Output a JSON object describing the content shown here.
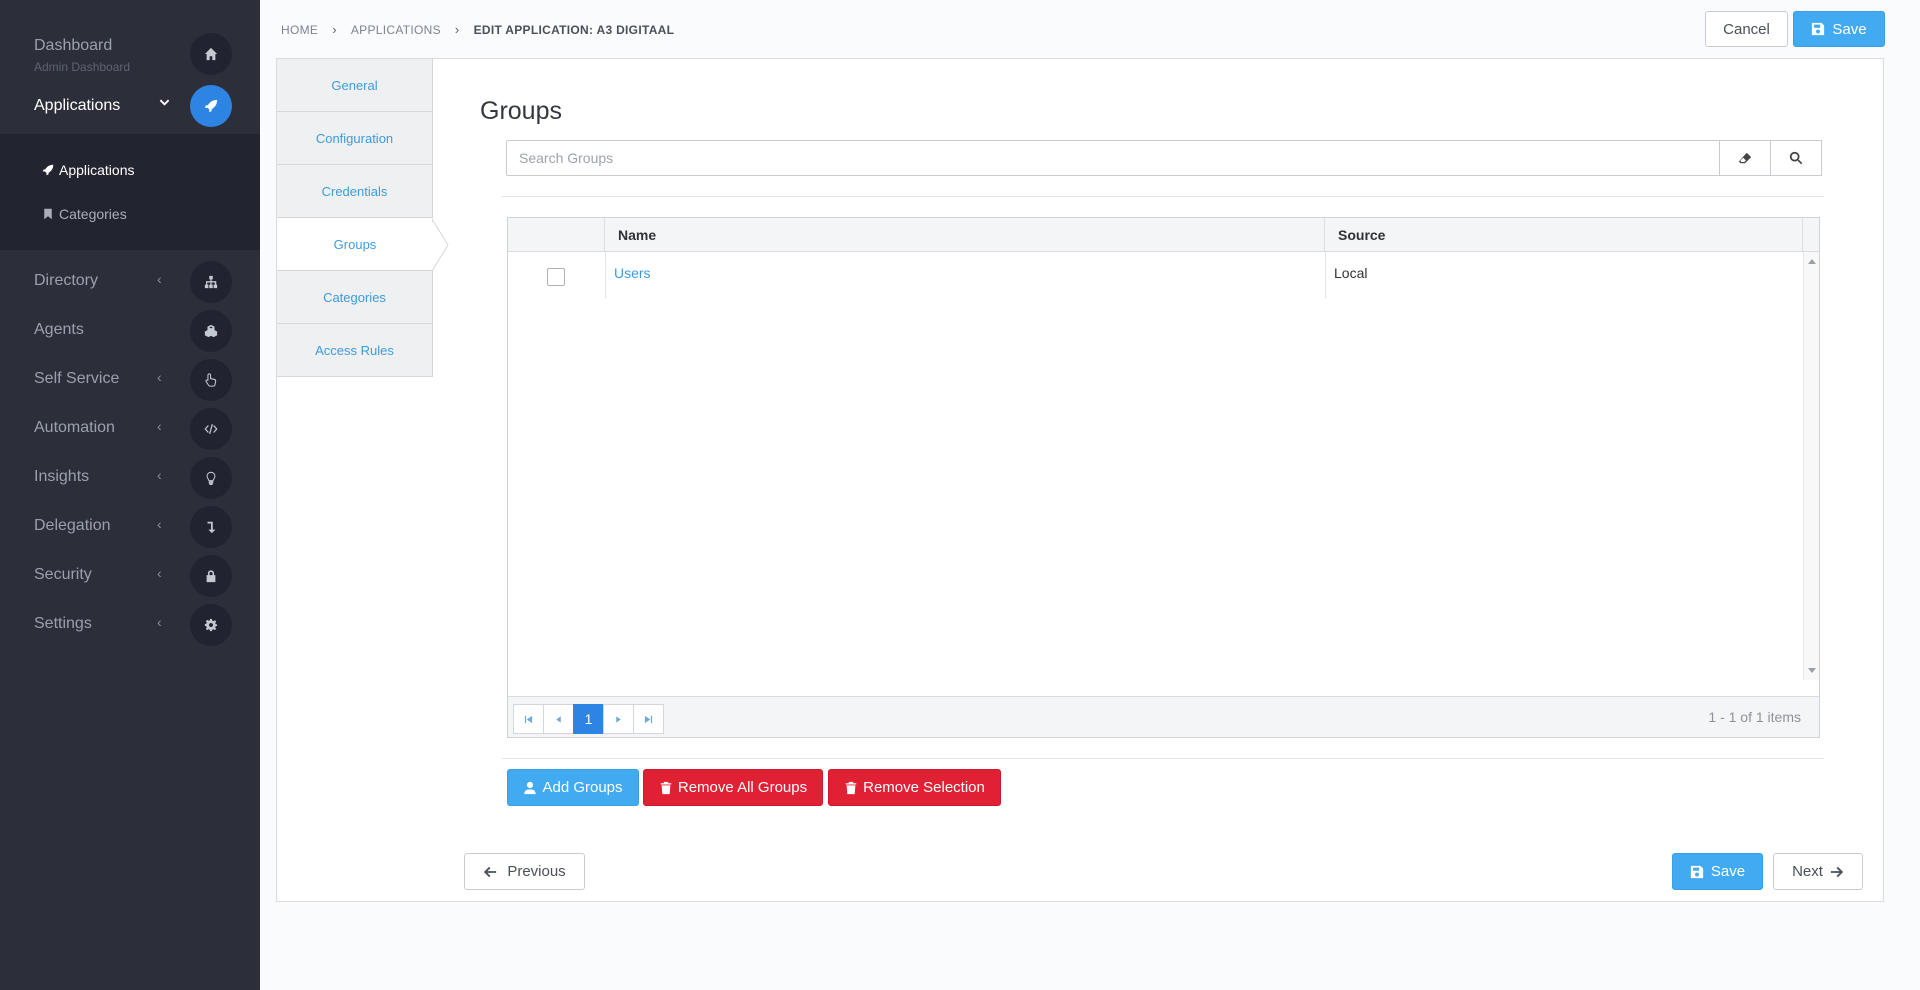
{
  "sidebar": {
    "dashboard": {
      "label": "Dashboard",
      "sublabel": "Admin Dashboard",
      "icon": "home-icon"
    },
    "applications": {
      "label": "Applications",
      "icon": "rocket-icon"
    },
    "submenu": [
      {
        "label": "Applications",
        "icon": "rocket-icon"
      },
      {
        "label": "Categories",
        "icon": "bookmark-icon"
      }
    ],
    "items": [
      {
        "label": "Directory",
        "icon": "sitemap-icon",
        "chevron": "‹"
      },
      {
        "label": "Agents",
        "icon": "cubes-icon",
        "chevron": ""
      },
      {
        "label": "Self Service",
        "icon": "hand-pointer-icon",
        "chevron": "‹"
      },
      {
        "label": "Automation",
        "icon": "code-icon",
        "chevron": "‹"
      },
      {
        "label": "Insights",
        "icon": "lightbulb-icon",
        "chevron": "‹"
      },
      {
        "label": "Delegation",
        "icon": "level-down-icon",
        "chevron": "‹"
      },
      {
        "label": "Security",
        "icon": "lock-icon",
        "chevron": "‹"
      },
      {
        "label": "Settings",
        "icon": "gear-icon",
        "chevron": "‹"
      }
    ]
  },
  "breadcrumb": {
    "home": "HOME",
    "applications": "APPLICATIONS",
    "current": "EDIT APPLICATION: A3 DIGITAAL",
    "separator": "›"
  },
  "header": {
    "cancel_label": "Cancel",
    "save_label": "Save"
  },
  "tabs": [
    {
      "label": "General"
    },
    {
      "label": "Configuration"
    },
    {
      "label": "Credentials"
    },
    {
      "label": "Groups"
    },
    {
      "label": "Categories"
    },
    {
      "label": "Access Rules"
    }
  ],
  "main": {
    "title": "Groups",
    "search": {
      "placeholder": "Search Groups",
      "value": ""
    },
    "grid": {
      "columns": [
        "Name",
        "Source"
      ],
      "rows": [
        {
          "name": "Users",
          "source": "Local"
        }
      ],
      "pager": {
        "page": "1",
        "info": "1 - 1 of 1 items"
      }
    },
    "actions": {
      "add_groups": "Add Groups",
      "remove_all": "Remove All Groups",
      "remove_selection": "Remove Selection"
    }
  },
  "footer": {
    "previous_label": "Previous",
    "save_label": "Save",
    "next_label": "Next"
  },
  "colors": {
    "sidebar_bg": "#2c2f3a",
    "accent_blue": "#41aaf1",
    "active_blue": "#2d84e3",
    "danger_red": "#e02033",
    "link_blue": "#3d9be0"
  }
}
